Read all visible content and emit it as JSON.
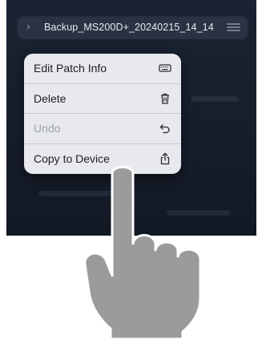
{
  "top_bar": {
    "title": "Backup_MS200D+_20240215_14_14",
    "icons": {
      "chevron": "chevron-right-icon",
      "menu": "hamburger-menu-icon"
    }
  },
  "context_menu": {
    "items": [
      {
        "label": "Edit Patch Info",
        "icon": "keyboard-icon",
        "enabled": true
      },
      {
        "label": "Delete",
        "icon": "trash-icon",
        "enabled": true
      },
      {
        "label": "Undo",
        "icon": "undo-icon",
        "enabled": false
      },
      {
        "label": "Copy to Device",
        "icon": "share-upload-icon",
        "enabled": true
      }
    ]
  },
  "colors": {
    "screen_bg": "#171e2b",
    "menu_bg": "#e7e9ee",
    "disabled_text": "#9ea2ab",
    "hand_fill": "#9b9b9b"
  }
}
